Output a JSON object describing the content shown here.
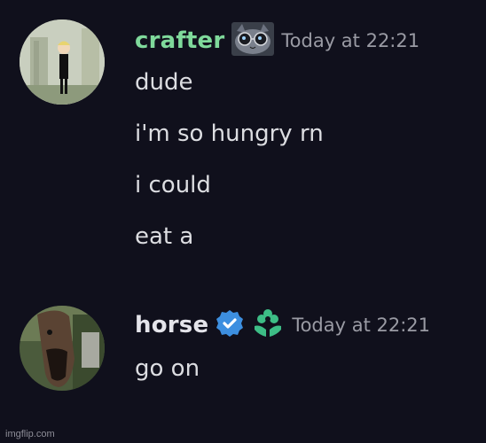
{
  "messages": [
    {
      "username": "crafter",
      "timestamp": "Today at 22:21",
      "lines": [
        "dude",
        "i'm so hungry rn",
        "i could",
        "eat a"
      ]
    },
    {
      "username": "horse",
      "timestamp": "Today at 22:21",
      "lines": [
        "go on"
      ]
    }
  ],
  "colors": {
    "crafter_name": "#7fd99b",
    "horse_name": "#e4e4ea",
    "verified_badge": "#3d8fe0",
    "green_badge": "#3dbd86",
    "background": "#10101c"
  },
  "icons": {
    "crafter_badge": "cat-with-glasses-icon",
    "horse_badge_1": "verified-check-icon",
    "horse_badge_2": "green-flower-badge-icon"
  },
  "watermark": "imgflip.com"
}
